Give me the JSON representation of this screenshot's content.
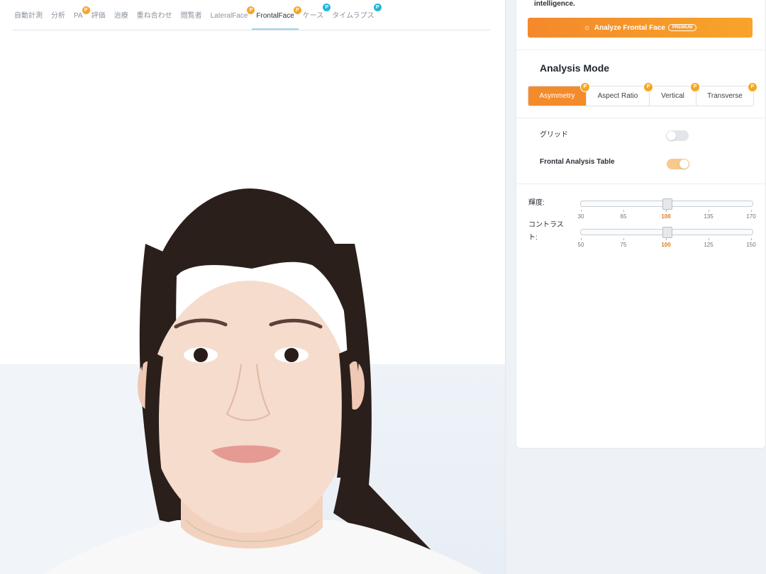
{
  "tabs": [
    {
      "label": "自動計測",
      "badge": ""
    },
    {
      "label": "分析",
      "badge": ""
    },
    {
      "label": "PA",
      "badge": "P"
    },
    {
      "label": "評価",
      "badge": ""
    },
    {
      "label": "治療",
      "badge": ""
    },
    {
      "label": "重ね合わせ",
      "badge": ""
    },
    {
      "label": "閲覧者",
      "badge": ""
    },
    {
      "label": "LateralFace",
      "badge": "P"
    },
    {
      "label": "FrontalFace",
      "badge": "P"
    },
    {
      "label": "ケース",
      "badge": "P"
    },
    {
      "label": "タイムラプス",
      "badge": "P"
    }
  ],
  "active_tab": "FrontalFace",
  "right": {
    "intro_text": "intelligence.",
    "analyze_label": "Analyze Frontal Face",
    "premium_label": "PREMIUM",
    "mode_title": "Analysis Mode",
    "modes": [
      {
        "label": "Asymmetry",
        "badge": "P"
      },
      {
        "label": "Aspect Ratio",
        "badge": "P"
      },
      {
        "label": "Vertical",
        "badge": "P"
      },
      {
        "label": "Transverse",
        "badge": "P"
      }
    ],
    "grid_label": "グリッド",
    "grid_on": false,
    "table_label": "Frontal Analysis Table",
    "table_on": true,
    "brightness_label": "輝度:",
    "brightness_value": 100,
    "brightness_ticks": [
      "30",
      "65",
      "100",
      "135",
      "170"
    ],
    "contrast_label_1": "コントラス",
    "contrast_label_2": "ト:",
    "contrast_value": 100,
    "contrast_ticks": [
      "50",
      "75",
      "100",
      "125",
      "150"
    ]
  },
  "colors": {
    "accent": "#f48b2b",
    "badge_orange": "#f5a623",
    "badge_blue": "#20b6d8"
  }
}
